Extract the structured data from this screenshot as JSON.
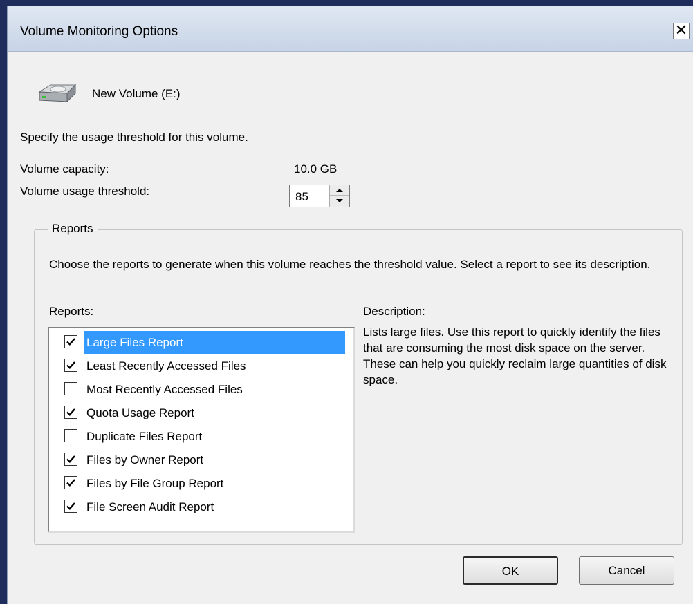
{
  "window": {
    "title": "Volume Monitoring Options",
    "close_glyph": "✕"
  },
  "volume": {
    "name": "New Volume (E:)",
    "icon": "drive-icon"
  },
  "threshold": {
    "instruction": "Specify the usage threshold for this volume.",
    "capacity_label": "Volume capacity:",
    "capacity_value": "10.0 GB",
    "usage_label": "Volume usage threshold:",
    "usage_value": "85"
  },
  "reports": {
    "group_label": "Reports",
    "instruction": "Choose the reports to generate when this volume reaches the threshold value. Select a report to see its description.",
    "list_label": "Reports:",
    "description_label": "Description:",
    "description_text": "Lists large files. Use this report to quickly identify the files that are consuming the most disk space on the server. These can help you quickly reclaim large quantities of disk space.",
    "items": [
      {
        "label": "Large Files Report",
        "checked": true,
        "selected": true
      },
      {
        "label": "Least Recently Accessed Files",
        "checked": true,
        "selected": false
      },
      {
        "label": "Most Recently Accessed Files",
        "checked": false,
        "selected": false
      },
      {
        "label": "Quota Usage Report",
        "checked": true,
        "selected": false
      },
      {
        "label": "Duplicate Files Report",
        "checked": false,
        "selected": false
      },
      {
        "label": "Files by Owner Report",
        "checked": true,
        "selected": false
      },
      {
        "label": "Files by File Group Report",
        "checked": true,
        "selected": false
      },
      {
        "label": "File Screen Audit Report",
        "checked": true,
        "selected": false
      }
    ]
  },
  "buttons": {
    "ok_label": "OK",
    "cancel_label": "Cancel"
  },
  "colors": {
    "selection": "#3399ff",
    "desktop": "#1f2d5c"
  }
}
